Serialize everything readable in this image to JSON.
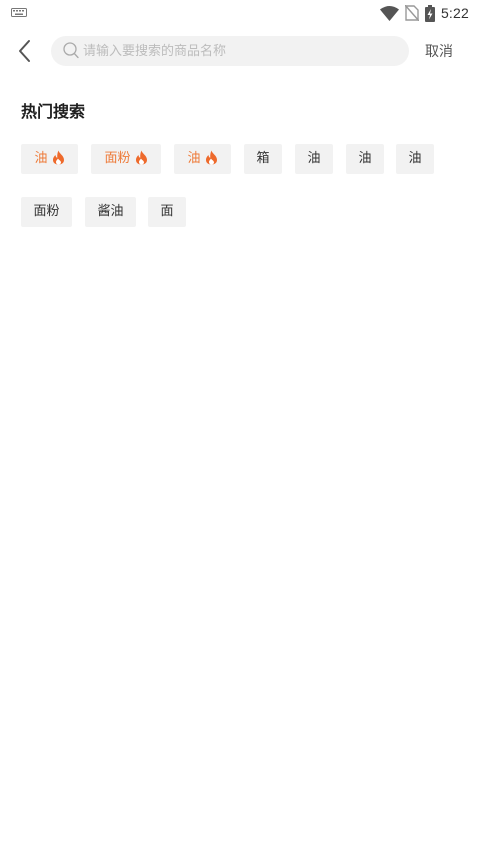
{
  "status_bar": {
    "time": "5:22",
    "icons": [
      "keyboard-icon",
      "wifi-icon",
      "no-sim-icon",
      "battery-charging-icon"
    ]
  },
  "header": {
    "back_icon": "chevron-left-icon",
    "search_icon": "search-icon",
    "search_placeholder": "请输入要搜索的商品名称",
    "search_value": "",
    "cancel_label": "取消"
  },
  "hot_search": {
    "title": "热门搜索",
    "hot_color": "#ee7a38",
    "tags": [
      {
        "label": "油",
        "hot": true
      },
      {
        "label": "面粉",
        "hot": true
      },
      {
        "label": "油",
        "hot": true
      },
      {
        "label": "箱",
        "hot": false
      },
      {
        "label": "油",
        "hot": false
      },
      {
        "label": "油",
        "hot": false
      },
      {
        "label": "油",
        "hot": false
      },
      {
        "label": "面粉",
        "hot": false
      },
      {
        "label": "酱油",
        "hot": false
      },
      {
        "label": "面",
        "hot": false
      }
    ]
  }
}
